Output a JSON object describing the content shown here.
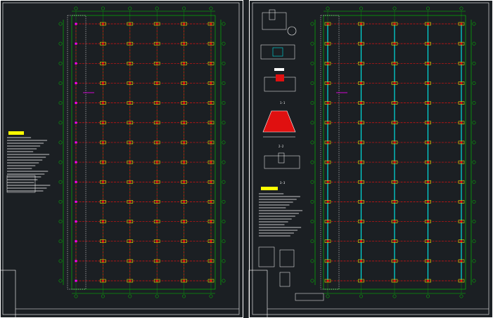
{
  "sheets": [
    {
      "id": "left",
      "label": "",
      "note_title": ""
    },
    {
      "id": "right",
      "label": "",
      "note_title": ""
    }
  ],
  "sections": [
    {
      "label": "1-1"
    },
    {
      "label": "2-2"
    },
    {
      "label": "3-3"
    }
  ],
  "colors": {
    "background": "#1b1f23",
    "frame": "#ffffff",
    "grid_line": "#00d000",
    "beam": "#e01010",
    "column_cap": "#e8e800",
    "stiffener": "#00e0e0",
    "marker": "#ff00ff",
    "note_highlight": "#ffff00"
  },
  "grid": {
    "left_cols": 6,
    "left_rows": 14,
    "right_cols": 5,
    "right_rows": 14
  }
}
